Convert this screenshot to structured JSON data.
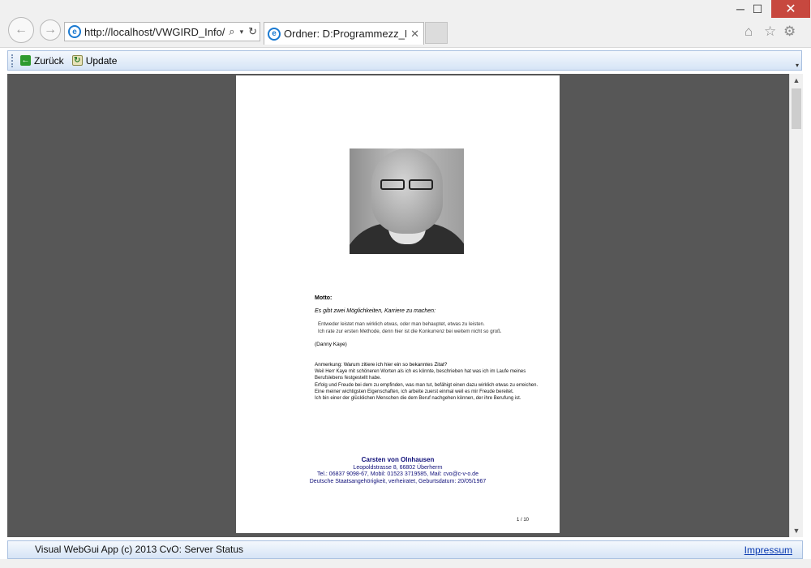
{
  "browser": {
    "address": "http://localhost/VWGIRD_Info/",
    "tab_title": "Ordner: D:Programmezz_Da...",
    "window_controls": {
      "minimize": "─",
      "maximize": "☐",
      "close": "✕"
    }
  },
  "toolbar": {
    "back_label": "Zurück",
    "update_label": "Update"
  },
  "document": {
    "motto_heading": "Motto:",
    "motto_intro": "Es gibt zwei Möglichkeiten, Karriere zu machen:",
    "quote_line_1": "Entweder leistet man wirklich etwas, oder man behauptet, etwas zu leisten.",
    "quote_line_2": "Ich rate zur ersten Methode, denn hier ist die Konkurrenz bei weitem nicht so groß.",
    "quote_author": "(Danny Kaye)",
    "note_heading": "Anmerkung: Warum zitiere ich hier ein so bekanntes Zitat?",
    "note_lines": [
      "Weil Herr Kaye mit schöneren Worten als ich es könnte, beschrieben hat was ich im Laufe meines",
      "Berufslebens festgestellt habe.",
      "Erfolg und Freude bei dem zu empfinden, was man tut, befähigt einen dazu wirklich etwas zu erreichen.",
      "Eine meiner wichtigsten Eigenschaften, ich arbeite zuerst einmal weil es mir Freude bereitet.",
      "Ich bin einer der glücklichen Menschen die dem Beruf nachgehen können, der ihre Berufung ist."
    ],
    "footer_name": "Carsten von Olnhausen",
    "footer_address": "Leopoldstrasse 8, 66802 Überherrn",
    "footer_contact": "Tel.: 06837 9098-67, Mobil: 01523 3719585, Mail: cvo@c-v-o.de",
    "footer_personal": "Deutsche Staatsangehörigkeit, verheiratet, Geburtsdatum: 20/05/1967",
    "page_number": "1 / 10"
  },
  "status": {
    "text": "Visual WebGui App (c) 2013 CvO: Server Status",
    "impressum": "Impressum"
  },
  "icons": {
    "back": "back-arrow-icon",
    "forward": "forward-arrow-icon",
    "search": "search-icon",
    "refresh": "refresh-icon",
    "home": "home-icon",
    "favorites": "star-icon",
    "settings": "gear-icon"
  }
}
